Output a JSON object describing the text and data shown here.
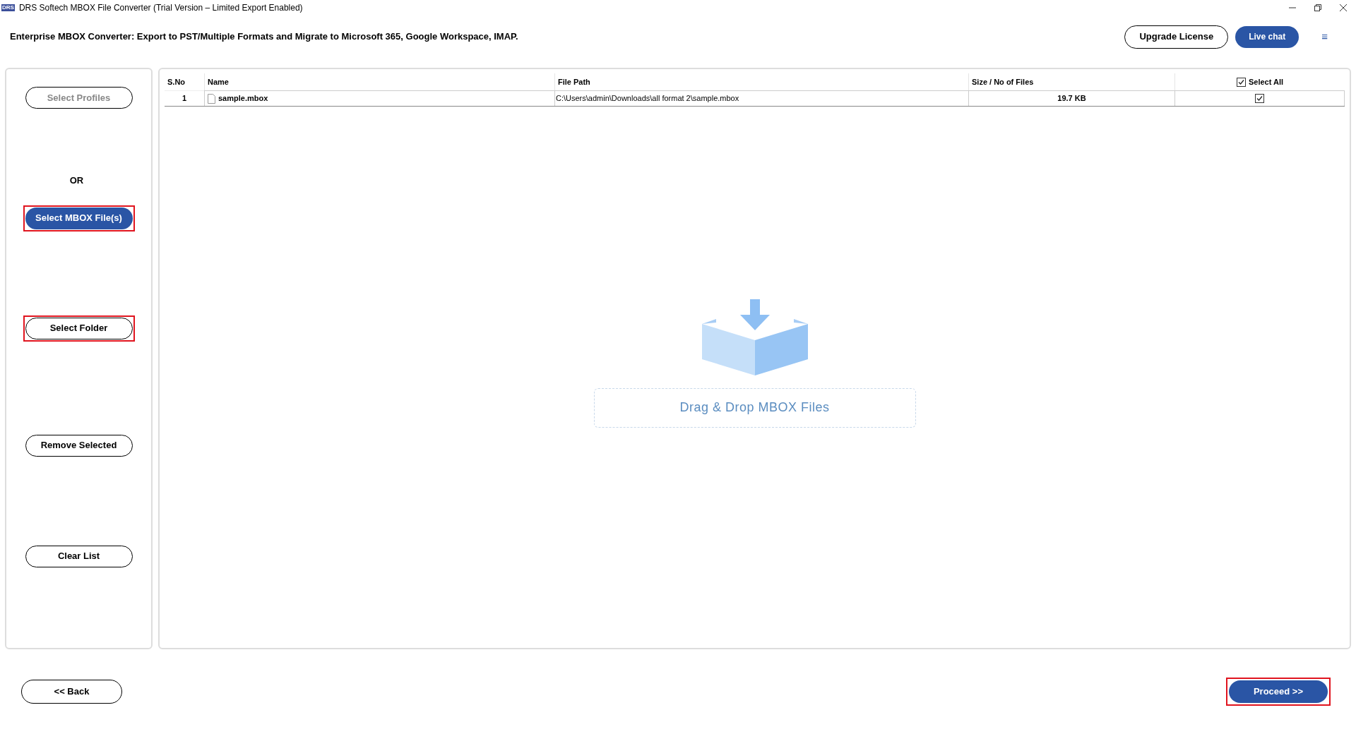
{
  "window": {
    "title": "DRS Softech MBOX File Converter (Trial Version – Limited Export Enabled)",
    "app_icon_text": "DRS"
  },
  "header": {
    "title": "Enterprise MBOX Converter: Export to PST/Multiple Formats and Migrate to Microsoft 365, Google Workspace, IMAP.",
    "upgrade_button": "Upgrade License",
    "chat_button": "Live chat",
    "menu_glyph": "≡"
  },
  "sidebar": {
    "items": [
      {
        "kind": "button",
        "label": "Select Profiles",
        "primary": false,
        "disabled": true,
        "highlighted": false
      },
      {
        "kind": "text",
        "label": "OR"
      },
      {
        "kind": "button",
        "label": "Select MBOX File(s)",
        "primary": true,
        "disabled": false,
        "highlighted": true
      },
      {
        "kind": "button",
        "label": "Select Folder",
        "primary": false,
        "disabled": false,
        "highlighted": true
      },
      {
        "kind": "button",
        "label": "Remove Selected",
        "primary": false,
        "disabled": false,
        "highlighted": false
      },
      {
        "kind": "button",
        "label": "Clear List",
        "primary": false,
        "disabled": false,
        "highlighted": false
      }
    ]
  },
  "table": {
    "columns": [
      "S.No",
      "Name",
      "File Path",
      "Size / No of Files"
    ],
    "select_all": {
      "label": "Select All",
      "checked": true
    },
    "rows": [
      {
        "sno": "1",
        "name": "sample.mbox",
        "path": "C:\\Users\\admin\\Downloads\\all format 2\\sample.mbox",
        "size": "19.7 KB",
        "checked": true
      }
    ]
  },
  "drop_zone": {
    "label": "Drag & Drop MBOX Files"
  },
  "footer": {
    "back_button": "<< Back",
    "proceed_button": {
      "label": "Proceed >>",
      "highlighted": true
    }
  }
}
